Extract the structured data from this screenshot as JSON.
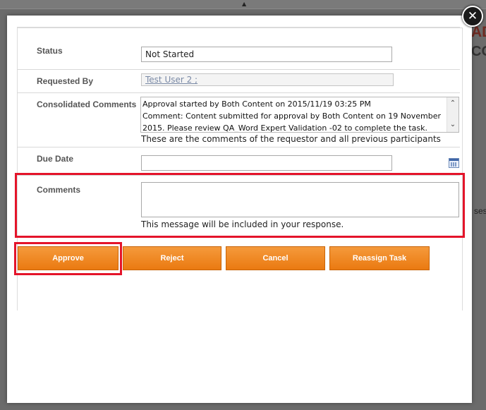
{
  "background": {
    "title_fragment_1": "AD",
    "title_fragment_2": "CO",
    "right_fragment": "ses"
  },
  "modal": {
    "close_glyph": "✕",
    "form": {
      "status": {
        "label": "Status",
        "value": "Not Started"
      },
      "requested_by": {
        "label": "Requested By",
        "value": "Test User 2 ;"
      },
      "consolidated_comments": {
        "label": "Consolidated Comments",
        "lines": [
          "Approval started by Both Content on 2015/11/19 03:25 PM",
          "Comment: Content submitted for approval by Both Content on 19 November",
          "2015. Please review QA_Word Expert Validation -02 to complete the task."
        ],
        "helper": "These are the comments of the requestor and all previous participants"
      },
      "due_date": {
        "label": "Due Date",
        "value": "",
        "icon": "calendar-icon"
      },
      "comments": {
        "label": "Comments",
        "value": "",
        "helper": "This message will be included in your response."
      }
    },
    "buttons": {
      "approve": "Approve",
      "reject": "Reject",
      "cancel": "Cancel",
      "reassign": "Reassign Task"
    },
    "colors": {
      "button": "#ea7a11",
      "highlight": "#e4142a"
    }
  }
}
